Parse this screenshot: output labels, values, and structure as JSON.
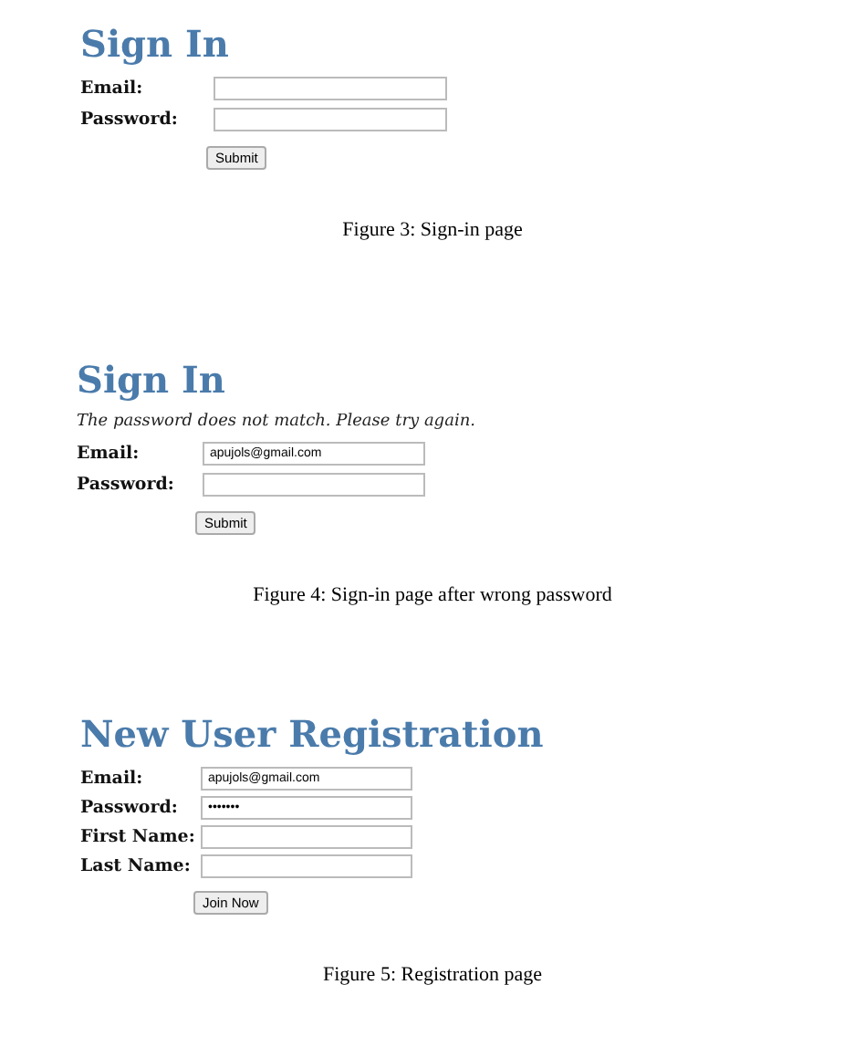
{
  "figures": [
    {
      "title": "Sign In",
      "fields": [
        {
          "label": "Email:"
        },
        {
          "label": "Password:"
        }
      ],
      "button": "Submit",
      "caption": "Figure 3: Sign-in page"
    },
    {
      "title": "Sign In",
      "message": "The password does not match. Please try again.",
      "fields": [
        {
          "label": "Email:",
          "value": "apujols@gmail.com"
        },
        {
          "label": "Password:"
        }
      ],
      "button": "Submit",
      "caption": "Figure 4: Sign-in page after wrong password"
    },
    {
      "title": "New User Registration",
      "fields": [
        {
          "label": "Email:",
          "value": "apujols@gmail.com"
        },
        {
          "label": "Password:",
          "value": "•••••••"
        },
        {
          "label": "First Name:"
        },
        {
          "label": "Last Name:"
        }
      ],
      "button": "Join Now",
      "caption": "Figure 5: Registration page"
    }
  ]
}
